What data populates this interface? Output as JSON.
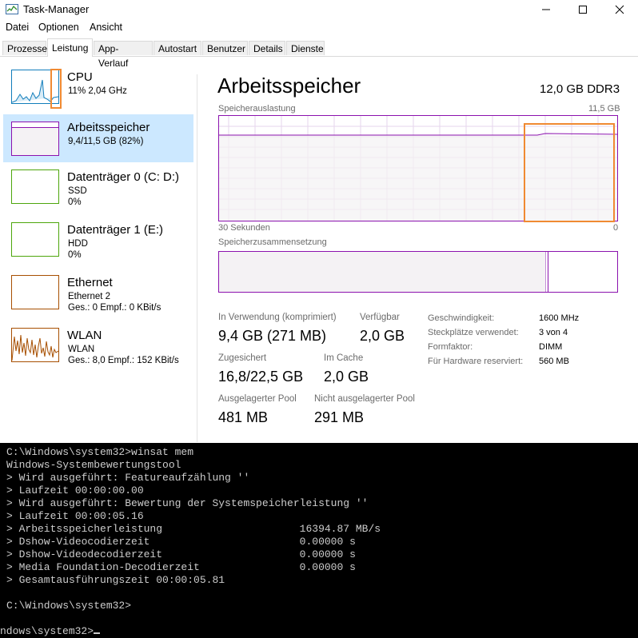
{
  "window": {
    "title": "Task-Manager",
    "controls": [
      "minimize",
      "maximize",
      "close"
    ]
  },
  "menu": [
    "Datei",
    "Optionen",
    "Ansicht"
  ],
  "tabs": [
    {
      "label": "Prozesse"
    },
    {
      "label": "Leistung",
      "active": true
    },
    {
      "label": "App-Verlauf"
    },
    {
      "label": "Autostart"
    },
    {
      "label": "Benutzer"
    },
    {
      "label": "Details"
    },
    {
      "label": "Dienste"
    }
  ],
  "sidebar": {
    "items": [
      {
        "name": "CPU",
        "line1": "11%  2,04 GHz",
        "line2": "",
        "color": "#117dbb"
      },
      {
        "name": "Arbeitsspeicher",
        "line1": "9,4/11,5 GB (82%)",
        "line2": "",
        "color": "#8b12ae",
        "selected": true,
        "usage": 0.82
      },
      {
        "name": "Datenträger 0 (C: D:)",
        "line1": "SSD",
        "line2": "0%",
        "color": "#4da60c"
      },
      {
        "name": "Datenträger 1 (E:)",
        "line1": "HDD",
        "line2": "0%",
        "color": "#4da60c"
      },
      {
        "name": "Ethernet",
        "line1": "Ethernet 2",
        "line2": "Ges.: 0  Empf.: 0 KBit/s",
        "color": "#a74f01"
      },
      {
        "name": "WLAN",
        "line1": "WLAN",
        "line2": "Ges.: 8,0  Empf.: 152 KBit/s",
        "color": "#a74f01"
      }
    ]
  },
  "main": {
    "title": "Arbeitsspeicher",
    "mem_type": "12,0 GB DDR3",
    "graph": {
      "label": "Speicherauslastung",
      "max_label": "11,5 GB",
      "time_label": "30 Sekunden",
      "min_label": "0",
      "usage": 0.82,
      "color": "#8b12ae"
    },
    "composition": {
      "label": "Speicherzusammensetzung",
      "in_use": 0.82,
      "modified": 0.005,
      "standby": 0.0
    },
    "stats": {
      "in_use_label": "In Verwendung (komprimiert)",
      "in_use_value": "9,4 GB (271 MB)",
      "available_label": "Verfügbar",
      "available_value": "2,0 GB",
      "committed_label": "Zugesichert",
      "committed_value": "16,8/22,5 GB",
      "cached_label": "Im Cache",
      "cached_value": "2,0 GB",
      "paged_label": "Ausgelagerter Pool",
      "paged_value": "481 MB",
      "nonpaged_label": "Nicht ausgelagerter Pool",
      "nonpaged_value": "291 MB"
    },
    "system": {
      "speed_label": "Geschwindigkeit:",
      "speed_value": "1600 MHz",
      "slots_label": "Steckplätze verwendet:",
      "slots_value": "3 von 4",
      "form_label": "Formfaktor:",
      "form_value": "DIMM",
      "reserved_label": "Für Hardware reserviert:",
      "reserved_value": "560 MB"
    }
  },
  "console": {
    "lines": [
      "C:\\Windows\\system32>winsat mem",
      "Windows-Systembewertungstool",
      "> Wird ausgeführt: Featureaufzählung ''",
      "> Laufzeit 00:00:00.00",
      "> Wird ausgeführt: Bewertung der Systemspeicherleistung ''",
      "> Laufzeit 00:00:05.16",
      "> Arbeitsspeicherleistung                      16394.87 MB/s",
      "> Dshow-Videocodierzeit                        0.00000 s",
      "> Dshow-Videodecodierzeit                      0.00000 s",
      "> Media Foundation-Decodierzeit                0.00000 s",
      "> Gesamtausführungszeit 00:00:05.81",
      "",
      "C:\\Windows\\system32>",
      "",
      "ndows\\system32>"
    ]
  },
  "highlight_color": "#f08a32"
}
